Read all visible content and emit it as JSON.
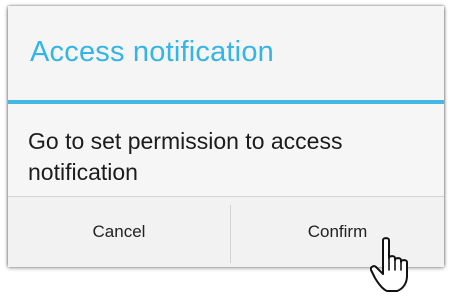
{
  "dialog": {
    "title": "Access notification",
    "message": "Go to set permission to access notification",
    "cancel_label": "Cancel",
    "confirm_label": "Confirm"
  },
  "cursor": {
    "icon": "pointing-hand-icon"
  },
  "colors": {
    "accent": "#33b5e5",
    "divider": "#45b7e4",
    "dialog_background": "#f4f4f4",
    "text": "#1c1c1c"
  }
}
